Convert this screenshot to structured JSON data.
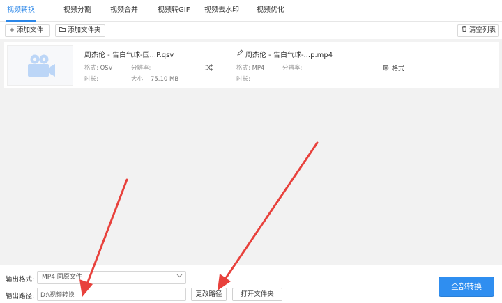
{
  "tabs": [
    {
      "label": "视频转换",
      "active": true
    },
    {
      "label": "视频分割",
      "active": false
    },
    {
      "label": "视频合并",
      "active": false
    },
    {
      "label": "视频转GIF",
      "active": false
    },
    {
      "label": "视频去水印",
      "active": false
    },
    {
      "label": "视频优化",
      "active": false
    }
  ],
  "toolbar": {
    "add_file": "添加文件",
    "add_folder": "添加文件夹",
    "clear_list": "清空列表"
  },
  "file": {
    "source_name": "周杰伦 - 告白气球-国...P.qsv",
    "source_format_label": "格式:",
    "source_format": "QSV",
    "source_resolution_label": "分辨率:",
    "source_resolution": "",
    "source_duration_label": "时长:",
    "source_duration": "",
    "source_size_label": "大小:",
    "source_size": "75.10 MB",
    "target_name": "周杰伦 - 告白气球-...p.mp4",
    "target_format_label": "格式:",
    "target_format": "MP4",
    "target_resolution_label": "分辨率:",
    "target_resolution": "",
    "target_duration_label": "时长:",
    "target_duration": "",
    "settings_label": "格式"
  },
  "output": {
    "format_label": "输出格式:",
    "format_value": "MP4  同原文件",
    "path_label": "输出路径:",
    "path_value": "D:\\视频转换",
    "change_path": "更改路径",
    "open_folder": "打开文件夹",
    "convert_all": "全部转换"
  },
  "colors": {
    "accent": "#2a86e8",
    "button_primary": "#2f8ef0",
    "annotation_arrow": "#e8413c"
  },
  "icons": {
    "add": "plus-icon",
    "folder": "folder-icon",
    "trash": "trash-icon",
    "edit": "pencil-icon",
    "swap": "shuffle-icon",
    "settings": "gear-icon",
    "thumbnail": "video-camera-icon"
  }
}
